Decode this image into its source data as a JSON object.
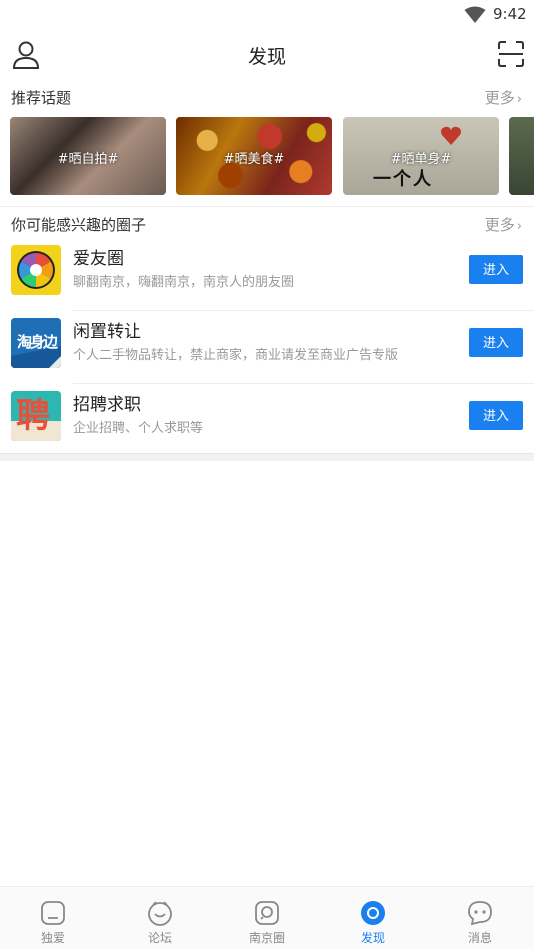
{
  "status_bar": {
    "time": "9:42",
    "wifi_icon": "wifi-icon"
  },
  "header": {
    "title": "发现",
    "left_icon": "profile-icon",
    "right_icon": "scan-icon"
  },
  "topics_section": {
    "label": "推荐话题",
    "more": "更多",
    "topics": [
      {
        "tag": "#晒自拍#"
      },
      {
        "tag": "#晒美食#"
      },
      {
        "tag": "#晒单身#",
        "image_text": "一个人"
      },
      {
        "tag": ""
      }
    ]
  },
  "circles_section": {
    "label": "你可能感兴趣的圈子",
    "more": "更多",
    "items": [
      {
        "name": "爱友圈",
        "desc": "聊翻南京，嗨翻南京，南京人的朋友圈",
        "button": "进入",
        "avatar_text": ""
      },
      {
        "name": "闲置转让",
        "desc": "个人二手物品转让，禁止商家，商业请发至商业广告专版",
        "button": "进入",
        "avatar_text": "淘身边"
      },
      {
        "name": "招聘求职",
        "desc": "企业招聘、个人求职等",
        "button": "进入",
        "avatar_text": "聘"
      }
    ]
  },
  "bottom_nav": {
    "items": [
      {
        "label": "独爱",
        "icon": "home-icon"
      },
      {
        "label": "论坛",
        "icon": "forum-icon"
      },
      {
        "label": "南京圈",
        "icon": "circle-chat-icon"
      },
      {
        "label": "发现",
        "icon": "discover-icon",
        "active": true
      },
      {
        "label": "消息",
        "icon": "message-icon"
      }
    ]
  },
  "colors": {
    "accent": "#1a80f0",
    "muted": "#999999"
  }
}
